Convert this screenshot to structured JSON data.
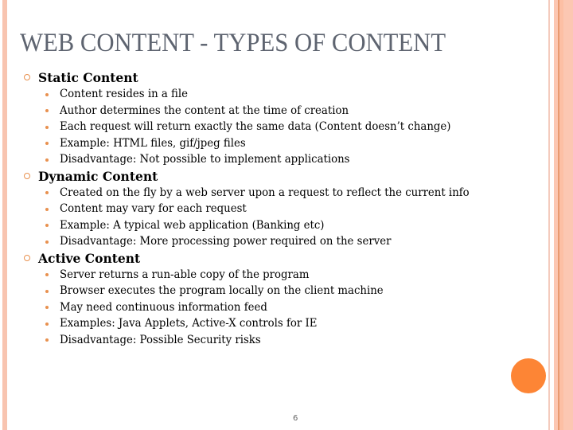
{
  "slide": {
    "title": "WEB CONTENT - TYPES OF CONTENT",
    "page_number": "6",
    "colors": {
      "title": "#5e6470",
      "bullet": "#e8914f",
      "accent_dot": "#fd8535",
      "border": "#f8c4b0"
    }
  },
  "sections": [
    {
      "heading": "Static Content",
      "items": [
        "Content resides in a file",
        "Author determines the content at the time of creation",
        "Each request will return exactly the same data (Content doesn’t change)",
        "Example: HTML files, gif/jpeg files",
        "Disadvantage: Not possible to implement applications"
      ]
    },
    {
      "heading": "Dynamic Content",
      "items": [
        "Created on the fly by a web server upon a request to reflect the current info",
        "Content may vary for each request",
        "Example: A typical web application (Banking etc)",
        "Disadvantage: More processing power required on the server"
      ]
    },
    {
      "heading": "Active Content",
      "items": [
        "Server returns a run-able copy of the program",
        "Browser executes the program locally on the client machine",
        "May need continuous information feed",
        "Examples: Java Applets, Active-X controls for IE",
        "Disadvantage: Possible Security risks"
      ]
    }
  ]
}
